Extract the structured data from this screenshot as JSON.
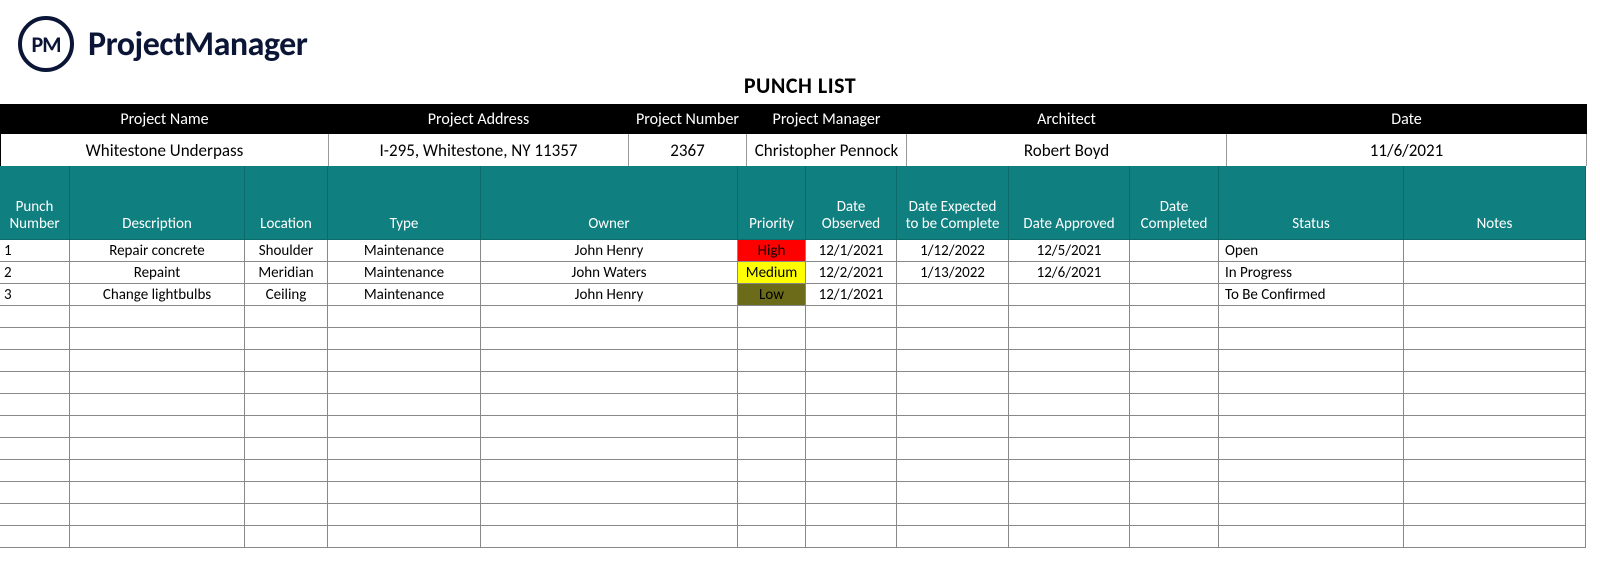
{
  "brand": {
    "icon_text": "PM",
    "name": "ProjectManager"
  },
  "title": "PUNCH LIST",
  "info": {
    "headers": [
      "Project Name",
      "Project Address",
      "Project Number",
      "Project Manager",
      "Architect",
      "Date"
    ],
    "values": [
      "Whitestone Underpass",
      "I-295, Whitestone, NY 11357",
      "2367",
      "Christopher Pennock",
      "Robert Boyd",
      "11/6/2021"
    ]
  },
  "table": {
    "headers": [
      "Punch Number",
      "Description",
      "Location",
      "Type",
      "Owner",
      "Priority",
      "Date Observed",
      "Date Expected to be Complete",
      "Date Approved",
      "Date Completed",
      "Status",
      "Notes"
    ],
    "rows": [
      {
        "num": "1",
        "desc": "Repair concrete",
        "loc": "Shoulder",
        "type": "Maintenance",
        "owner": "John Henry",
        "prio": "High",
        "observed": "12/1/2021",
        "expected": "1/12/2022",
        "approved": "12/5/2021",
        "completed": "",
        "status": "Open",
        "notes": ""
      },
      {
        "num": "2",
        "desc": "Repaint",
        "loc": "Meridian",
        "type": "Maintenance",
        "owner": "John Waters",
        "prio": "Medium",
        "observed": "12/2/2021",
        "expected": "1/13/2022",
        "approved": "12/6/2021",
        "completed": "",
        "status": "In Progress",
        "notes": ""
      },
      {
        "num": "3",
        "desc": "Change lightbulbs",
        "loc": "Ceiling",
        "type": "Maintenance",
        "owner": "John Henry",
        "prio": "Low",
        "observed": "12/1/2021",
        "expected": "",
        "approved": "",
        "completed": "",
        "status": "To Be Confirmed",
        "notes": ""
      }
    ],
    "empty_row_count": 11,
    "priority_colors": {
      "High": "#ff0000",
      "Medium": "#ffff00",
      "Low": "#6b6b1a"
    }
  }
}
